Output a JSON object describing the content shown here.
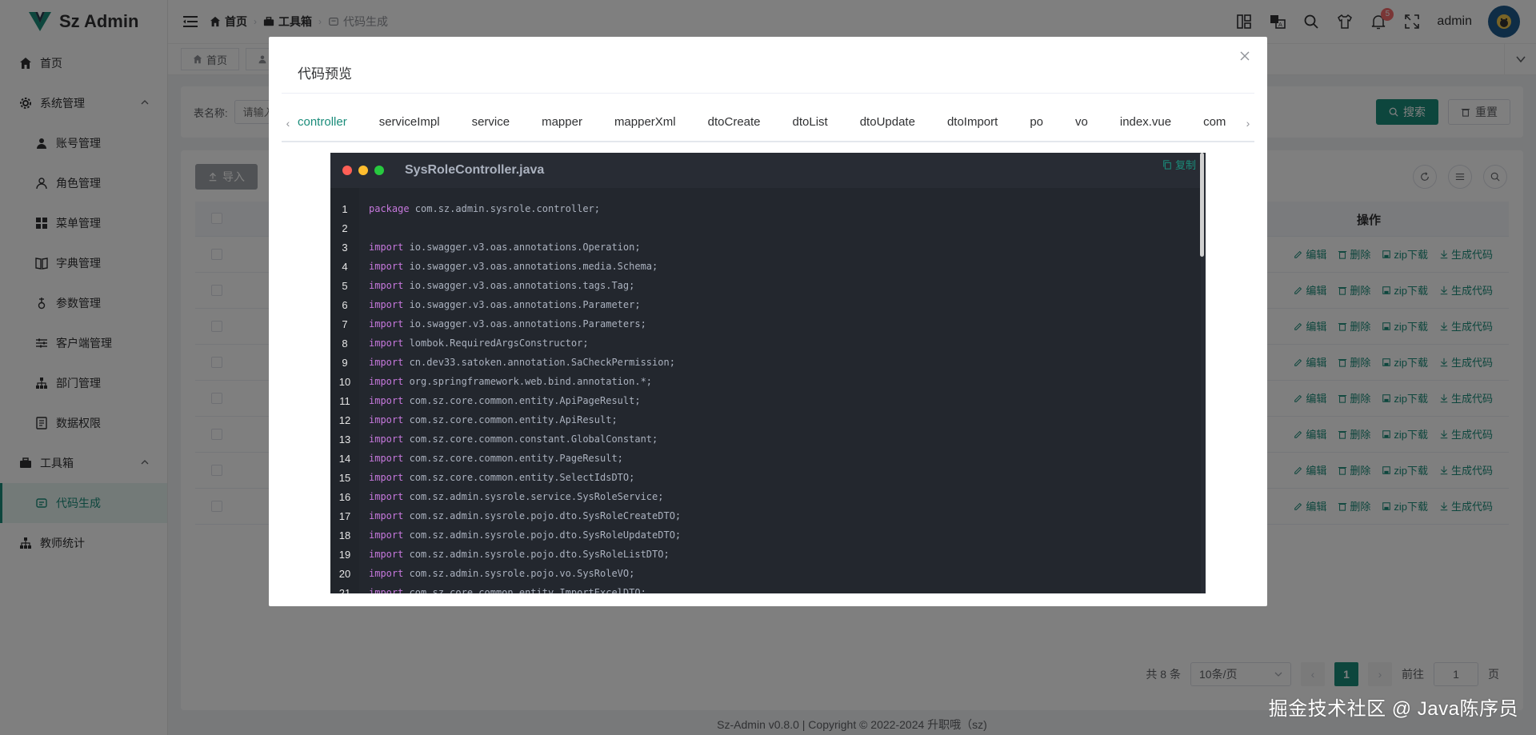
{
  "app": {
    "title": "Sz Admin"
  },
  "sidebar": {
    "items": [
      {
        "label": "首页",
        "icon": "home-icon",
        "level": 0
      },
      {
        "label": "系统管理",
        "icon": "gear-icon",
        "level": 0,
        "expanded": true
      },
      {
        "label": "账号管理",
        "icon": "user-icon",
        "level": 1
      },
      {
        "label": "角色管理",
        "icon": "user-outline-icon",
        "level": 1
      },
      {
        "label": "菜单管理",
        "icon": "grid-icon",
        "level": 1
      },
      {
        "label": "字典管理",
        "icon": "book-icon",
        "level": 1
      },
      {
        "label": "参数管理",
        "icon": "param-icon",
        "level": 1
      },
      {
        "label": "客户端管理",
        "icon": "sliders-icon",
        "level": 1
      },
      {
        "label": "部门管理",
        "icon": "org-icon",
        "level": 1
      },
      {
        "label": "数据权限",
        "icon": "data-icon",
        "level": 1
      },
      {
        "label": "工具箱",
        "icon": "toolbox-icon",
        "level": 0,
        "expanded": true
      },
      {
        "label": "代码生成",
        "icon": "codegen-icon",
        "level": 1,
        "active": true
      },
      {
        "label": "教师统计",
        "icon": "org-icon",
        "level": 0
      }
    ]
  },
  "header": {
    "breadcrumb": [
      "首页",
      "工具箱",
      "代码生成"
    ],
    "notification_count": "5",
    "username": "admin"
  },
  "tabsbar": {
    "tags": [
      "首页"
    ]
  },
  "search": {
    "label": "表名称:",
    "placeholder": "请输入表名称",
    "search_label": "搜索",
    "reset_label": "重置"
  },
  "table": {
    "import_label": "导入",
    "ops_header": "操作",
    "row_ops": [
      "编辑",
      "删除",
      "zip下载",
      "生成代码"
    ],
    "row_count": 8
  },
  "pagination": {
    "total": "共 8 条",
    "page_size": "10条/页",
    "current": "1",
    "goto_label": "前往",
    "goto_value": "1",
    "page_suffix": "页"
  },
  "footer": {
    "text": "Sz-Admin v0.8.0 | Copyright © 2022-2024 升职哦（sz)"
  },
  "watermark": {
    "text": "掘金技术社区 @ Java陈序员"
  },
  "dialog": {
    "title": "代码预览",
    "tabs": [
      "controller",
      "serviceImpl",
      "service",
      "mapper",
      "mapperXml",
      "dtoCreate",
      "dtoList",
      "dtoUpdate",
      "dtoImport",
      "po",
      "vo",
      "index.vue",
      "com"
    ],
    "active_tab": "controller",
    "filename": "SysRoleController.java",
    "copy_label": "复制",
    "code_lines": [
      {
        "n": "1",
        "kw": "package",
        "rest": " com.sz.admin.sysrole.controller;"
      },
      {
        "n": "2",
        "kw": "",
        "rest": ""
      },
      {
        "n": "3",
        "kw": "import",
        "rest": " io.swagger.v3.oas.annotations.Operation;"
      },
      {
        "n": "4",
        "kw": "import",
        "rest": " io.swagger.v3.oas.annotations.media.Schema;"
      },
      {
        "n": "5",
        "kw": "import",
        "rest": " io.swagger.v3.oas.annotations.tags.Tag;"
      },
      {
        "n": "6",
        "kw": "import",
        "rest": " io.swagger.v3.oas.annotations.Parameter;"
      },
      {
        "n": "7",
        "kw": "import",
        "rest": " io.swagger.v3.oas.annotations.Parameters;"
      },
      {
        "n": "8",
        "kw": "import",
        "rest": " lombok.RequiredArgsConstructor;"
      },
      {
        "n": "9",
        "kw": "import",
        "rest": " cn.dev33.satoken.annotation.SaCheckPermission;"
      },
      {
        "n": "10",
        "kw": "import",
        "rest": " org.springframework.web.bind.annotation.*;"
      },
      {
        "n": "11",
        "kw": "import",
        "rest": " com.sz.core.common.entity.ApiPageResult;"
      },
      {
        "n": "12",
        "kw": "import",
        "rest": " com.sz.core.common.entity.ApiResult;"
      },
      {
        "n": "13",
        "kw": "import",
        "rest": " com.sz.core.common.constant.GlobalConstant;"
      },
      {
        "n": "14",
        "kw": "import",
        "rest": " com.sz.core.common.entity.PageResult;"
      },
      {
        "n": "15",
        "kw": "import",
        "rest": " com.sz.core.common.entity.SelectIdsDTO;"
      },
      {
        "n": "16",
        "kw": "import",
        "rest": " com.sz.admin.sysrole.service.SysRoleService;"
      },
      {
        "n": "17",
        "kw": "import",
        "rest": " com.sz.admin.sysrole.pojo.dto.SysRoleCreateDTO;"
      },
      {
        "n": "18",
        "kw": "import",
        "rest": " com.sz.admin.sysrole.pojo.dto.SysRoleUpdateDTO;"
      },
      {
        "n": "19",
        "kw": "import",
        "rest": " com.sz.admin.sysrole.pojo.dto.SysRoleListDTO;"
      },
      {
        "n": "20",
        "kw": "import",
        "rest": " com.sz.admin.sysrole.pojo.vo.SysRoleVO;"
      },
      {
        "n": "21",
        "kw": "import",
        "rest": " com.sz.core.common.entity.ImportExcelDTO;"
      }
    ]
  },
  "colors": {
    "accent": "#1a8c7a",
    "code_bg": "#23272e",
    "keyword": "#c678dd"
  }
}
